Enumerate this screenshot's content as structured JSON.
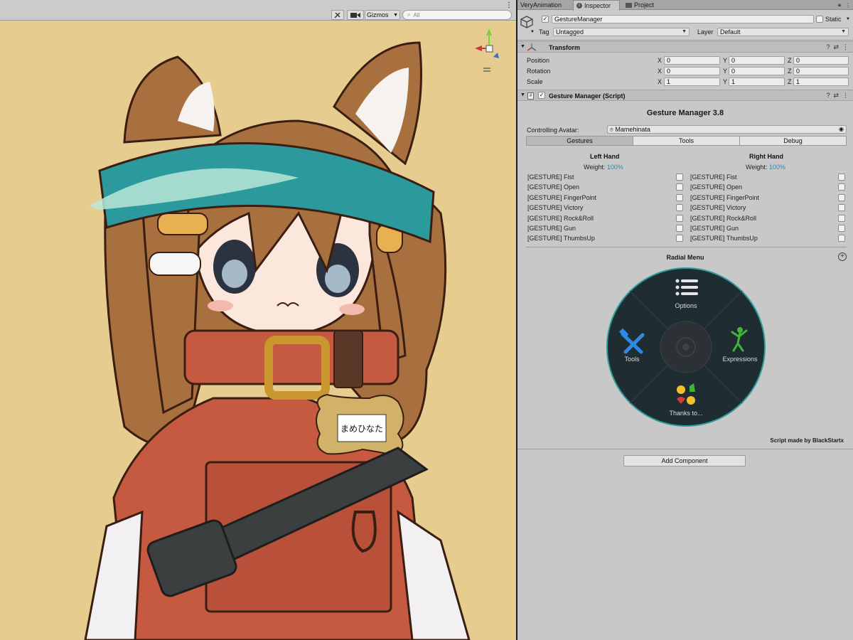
{
  "scene": {
    "gizmos_label": "Gizmos",
    "search_placeholder": "All",
    "tag_text": "まめひなた",
    "icon_names": [
      "tools-icon",
      "camera-icon",
      "chevron-down-icon",
      "search-icon",
      "more-icon"
    ]
  },
  "tabs": [
    {
      "label": "VeryAnimation"
    },
    {
      "label": "Inspector"
    },
    {
      "label": "Project"
    }
  ],
  "gameobject": {
    "enabled": "✓",
    "name": "GestureManager",
    "static_label": "Static",
    "tag_label": "Tag",
    "tag_value": "Untagged",
    "layer_label": "Layer",
    "layer_value": "Default"
  },
  "transform": {
    "title": "Transform",
    "rows": [
      {
        "label": "Position",
        "x": "0",
        "y": "0",
        "z": "0"
      },
      {
        "label": "Rotation",
        "x": "0",
        "y": "0",
        "z": "0"
      },
      {
        "label": "Scale",
        "x": "1",
        "y": "1",
        "z": "1"
      }
    ],
    "axis_x": "X",
    "axis_y": "Y",
    "axis_z": "Z"
  },
  "gesture_component": {
    "title": "Gesture Manager (Script)",
    "heading": "Gesture Manager 3.8",
    "controlling_label": "Controlling Avatar:",
    "controlling_value": "Mamehinata",
    "toolbar": [
      "Gestures",
      "Tools",
      "Debug"
    ],
    "left_hand": {
      "title": "Left Hand",
      "weight_label": "Weight:",
      "weight_value": "100%"
    },
    "right_hand": {
      "title": "Right Hand",
      "weight_label": "Weight:",
      "weight_value": "100%"
    },
    "gestures": [
      "[GESTURE] Fist",
      "[GESTURE] Open",
      "[GESTURE] FingerPoint",
      "[GESTURE] Victory",
      "[GESTURE] Rock&Roll",
      "[GESTURE] Gun",
      "[GESTURE] ThumbsUp"
    ],
    "radial_title": "Radial Menu",
    "radial": {
      "options": "Options",
      "tools": "Tools",
      "expressions": "Expressions",
      "thanks": "Thanks to..."
    },
    "credit": "Script made by BlackStartx"
  },
  "add_component": "Add Component",
  "colors": {
    "scene_bg": "#e6cd8f",
    "inspector_bg": "#c8c8c8",
    "radial_bg": "#1d2b31",
    "radial_ring": "#2a9b9a",
    "weight_accent": "#2b8bb5"
  }
}
